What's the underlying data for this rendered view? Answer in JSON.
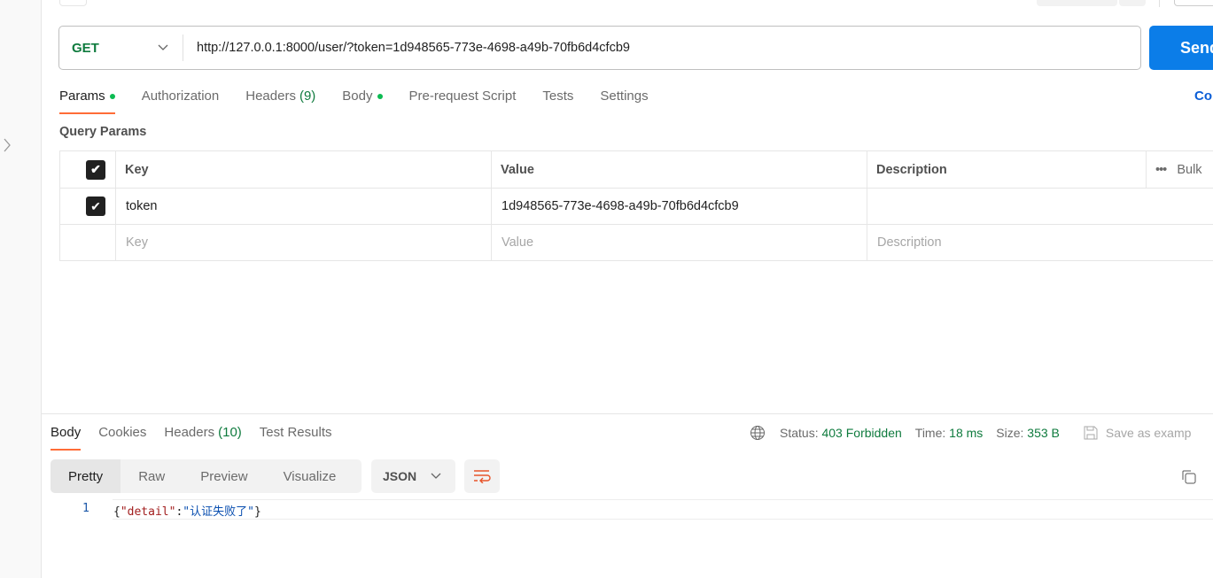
{
  "request": {
    "method": "GET",
    "url": "http://127.0.0.1:8000/user/?token=1d948565-773e-4698-a49b-70fb6d4cfcb9",
    "send_label": "Send",
    "cookies_label": "Co"
  },
  "request_tabs": [
    {
      "label": "Params",
      "dot": true
    },
    {
      "label": "Authorization"
    },
    {
      "label": "Headers",
      "count": "(9)"
    },
    {
      "label": "Body",
      "dot": true
    },
    {
      "label": "Pre-request Script"
    },
    {
      "label": "Tests"
    },
    {
      "label": "Settings"
    }
  ],
  "query_params": {
    "title": "Query Params",
    "headers": {
      "key": "Key",
      "value": "Value",
      "description": "Description",
      "bulk": "Bulk"
    },
    "rows": [
      {
        "checked": true,
        "key": "token",
        "value": "1d948565-773e-4698-a49b-70fb6d4cfcb9",
        "description": ""
      }
    ],
    "placeholders": {
      "key": "Key",
      "value": "Value",
      "description": "Description"
    }
  },
  "response": {
    "tabs": [
      {
        "label": "Body"
      },
      {
        "label": "Cookies"
      },
      {
        "label": "Headers",
        "count": "(10)"
      },
      {
        "label": "Test Results"
      }
    ],
    "status_label": "Status:",
    "status": "403 Forbidden",
    "time_label": "Time:",
    "time": "18 ms",
    "size_label": "Size:",
    "size": "353 B",
    "save_label": "Save as examp",
    "formats": [
      "Pretty",
      "Raw",
      "Preview",
      "Visualize"
    ],
    "language": "JSON",
    "line_number": "1",
    "body": {
      "brace_open": "{",
      "key": "\"detail\"",
      "colon": ":",
      "value": "\"认证失败了\"",
      "brace_close": "}"
    }
  },
  "colors": {
    "send": "#0b7de8",
    "accent": "#ff6c37",
    "status": "#0f7b3e"
  }
}
